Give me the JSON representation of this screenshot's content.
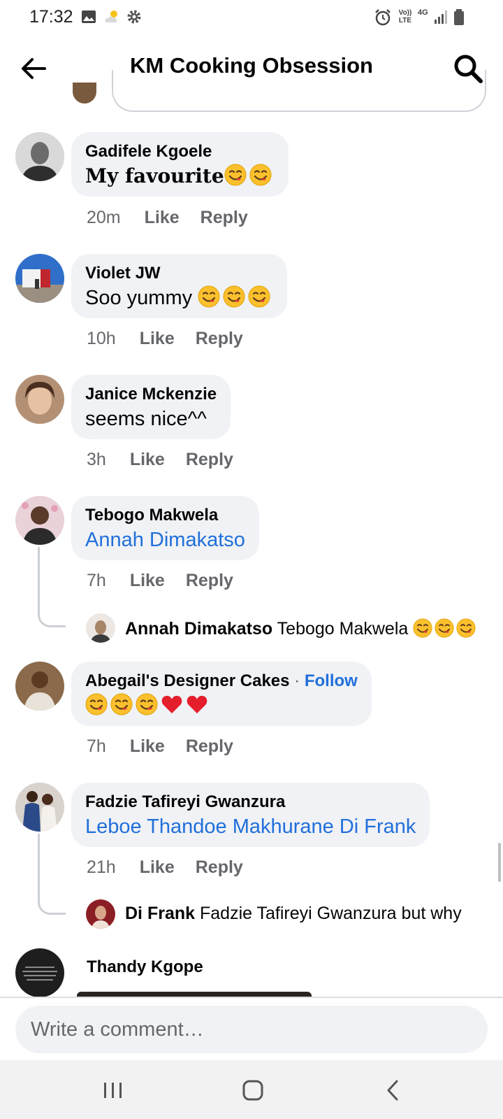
{
  "status_bar": {
    "time": "17:32",
    "network_label": "4G",
    "volte_label": "Vo)) LTE",
    "left_icons": [
      "gallery-icon",
      "weather-icon",
      "settings-gear-icon"
    ],
    "right_icons": [
      "alarm-icon",
      "volte-icon",
      "4g-data-icon",
      "signal-icon",
      "battery-icon"
    ]
  },
  "header": {
    "title": "KM Cooking Obsession",
    "back_icon": "back-arrow-icon",
    "search_icon": "search-icon"
  },
  "comments": [
    {
      "author": "Gadifele Kgoele",
      "text": "My favourite",
      "emojis": [
        "face-savoring-food",
        "face-savoring-food"
      ],
      "time": "20m",
      "like_label": "Like",
      "reply_label": "Reply"
    },
    {
      "author": "Violet JW",
      "text": "Soo yummy",
      "emojis": [
        "face-savoring-food",
        "face-savoring-food",
        "face-savoring-food"
      ],
      "time": "10h",
      "like_label": "Like",
      "reply_label": "Reply"
    },
    {
      "author": "Janice Mckenzie",
      "text": "seems nice^^",
      "emojis": [],
      "time": "3h",
      "like_label": "Like",
      "reply_label": "Reply"
    },
    {
      "author": "Tebogo Makwela",
      "mention": "Annah Dimakatso",
      "time": "7h",
      "like_label": "Like",
      "reply_label": "Reply",
      "reply": {
        "author": "Annah Dimakatso",
        "text": "Tebogo Makwela",
        "emojis": [
          "face-savoring-food",
          "face-savoring-food",
          "face-savoring-food"
        ]
      }
    },
    {
      "author": "Abegail's Designer Cakes",
      "follow_separator": "·",
      "follow_label": "Follow",
      "emojis": [
        "face-savoring-food",
        "face-savoring-food",
        "face-savoring-food",
        "red-heart",
        "red-heart"
      ],
      "time": "7h",
      "like_label": "Like",
      "reply_label": "Reply"
    },
    {
      "author": "Fadzie Tafireyi Gwanzura",
      "mentions": "Leboe Thandoe Makhurane  Di Frank",
      "time": "21h",
      "like_label": "Like",
      "reply_label": "Reply",
      "reply": {
        "author": "Di Frank",
        "text": "Fadzie Tafireyi Gwanzura but why"
      }
    },
    {
      "author": "Thandy Kgope"
    }
  ],
  "composer": {
    "placeholder": "Write a comment…"
  },
  "nav_bar": {
    "icons": [
      "recent-apps-icon",
      "home-icon",
      "back-icon"
    ]
  },
  "colors": {
    "link": "#216fdb",
    "bubble": "#f0f2f5",
    "secondary_text": "#65676b",
    "heart": "#e41e2b",
    "emoji_face": "#fbc02d"
  }
}
